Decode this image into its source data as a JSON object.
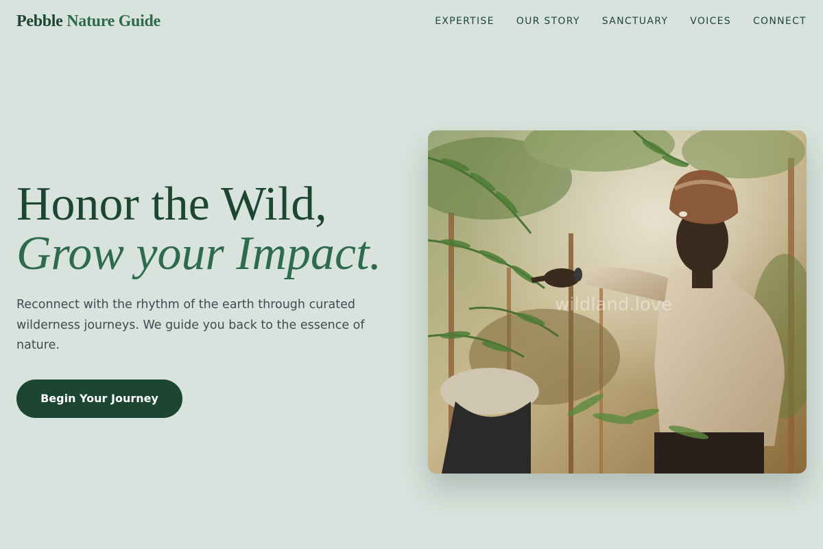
{
  "brand": {
    "word1": "Pebble",
    "word2": "Nature Guide"
  },
  "nav": {
    "items": [
      {
        "label": "EXPERTISE"
      },
      {
        "label": "OUR STORY"
      },
      {
        "label": "SANCTUARY"
      },
      {
        "label": "VOICES"
      },
      {
        "label": "CONNECT"
      }
    ]
  },
  "hero": {
    "title_line1": "Honor the Wild,",
    "title_line2": "Grow your Impact.",
    "description": "Reconnect with the rhythm of the earth through curated wilderness journeys. We guide you back to the essence of nature.",
    "cta_label": "Begin Your Journey",
    "image": {
      "watermark": "wildland.love"
    }
  },
  "colors": {
    "background": "#d9e3dd",
    "brand_dark": "#1c4534",
    "brand_green": "#2e6a4d",
    "body_text": "#3f4a52",
    "button_text": "#ffffff"
  }
}
